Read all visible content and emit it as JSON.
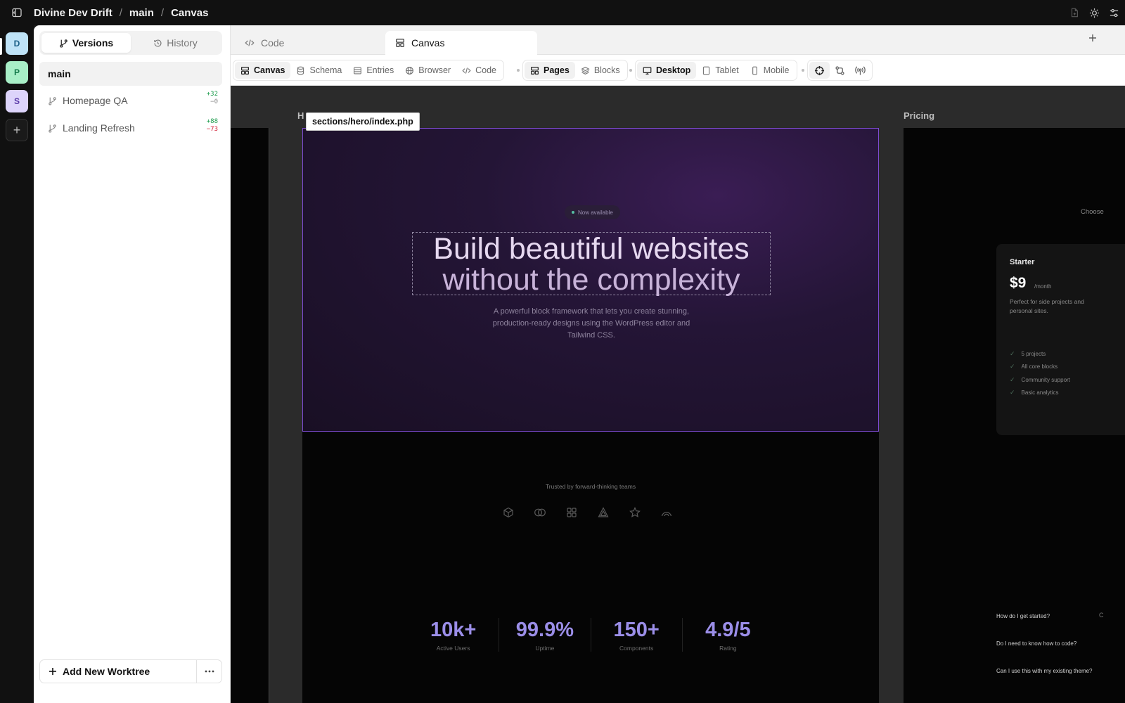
{
  "topbar": {
    "breadcrumbs": [
      "Divine Dev Drift",
      "main",
      "Canvas"
    ]
  },
  "workspaces": [
    "D",
    "P",
    "S"
  ],
  "workspace_colors": [
    "#bfe3f7",
    "#a8efc7",
    "#ddd4fb"
  ],
  "sidebar": {
    "tabs": [
      {
        "label": "Versions",
        "icon": "branch-icon",
        "active": true
      },
      {
        "label": "History",
        "icon": "history-icon",
        "active": false
      }
    ],
    "current_branch": "main",
    "worktrees": [
      {
        "name": "Homepage QA",
        "added": "+32",
        "removed": "−0"
      },
      {
        "name": "Landing Refresh",
        "added": "+88",
        "removed": "−73"
      }
    ],
    "add_worktree_label": "Add New Worktree"
  },
  "editor_tabs": [
    {
      "label": "Code",
      "icon": "code-icon",
      "active": false
    },
    {
      "label": "Canvas",
      "icon": "layout-icon",
      "active": true
    }
  ],
  "toolbar": {
    "view_group": [
      {
        "label": "Canvas",
        "icon": "layout-icon",
        "active": true
      },
      {
        "label": "Schema",
        "icon": "database-icon",
        "active": false
      },
      {
        "label": "Entries",
        "icon": "list-icon",
        "active": false
      },
      {
        "label": "Browser",
        "icon": "globe-icon",
        "active": false
      },
      {
        "label": "Code",
        "icon": "code-icon",
        "active": false
      }
    ],
    "content_group": [
      {
        "label": "Pages",
        "icon": "pages-icon",
        "active": true
      },
      {
        "label": "Blocks",
        "icon": "layers-icon",
        "active": false
      }
    ],
    "device_group": [
      {
        "label": "Desktop",
        "icon": "monitor-icon",
        "active": true
      },
      {
        "label": "Tablet",
        "icon": "tablet-icon",
        "active": false
      },
      {
        "label": "Mobile",
        "icon": "phone-icon",
        "active": false
      }
    ],
    "tools_group": [
      "crosshair-icon",
      "git-compare-icon",
      "broadcast-icon"
    ]
  },
  "canvas": {
    "home_frame_label": "H",
    "pricing_frame_label": "Pricing",
    "selected_file_tooltip": "sections/hero/index.php",
    "hero": {
      "badge": "Now available",
      "headline_line1": "Build beautiful websites",
      "headline_line2": "without the complexity",
      "subtitle": "A powerful block framework that lets you create stunning, production-ready designs using the WordPress editor and Tailwind CSS."
    },
    "trusted_text": "Trusted by forward-thinking teams",
    "logo_icons": [
      "cube-icon",
      "rings-icon",
      "grid-icon",
      "triangle-icon",
      "star-icon",
      "arc-icon"
    ],
    "stats": [
      {
        "value": "10k+",
        "label": "Active Users"
      },
      {
        "value": "99.9%",
        "label": "Uptime"
      },
      {
        "value": "150+",
        "label": "Components"
      },
      {
        "value": "4.9/5",
        "label": "Rating"
      }
    ],
    "pricing": {
      "intro_text": "Choose",
      "plan_name": "Starter",
      "price": "$9",
      "period": "/month",
      "description": "Perfect for side projects and personal sites.",
      "features": [
        "5 projects",
        "All core blocks",
        "Community support",
        "Basic analytics"
      ],
      "edge_letter": "C",
      "faq": [
        "How do I get started?",
        "Do I need to know how to code?",
        "Can I use this with my existing theme?"
      ]
    }
  },
  "colors": {
    "accent_purple": "#7d4bd1",
    "stat_value": "#9b8ee8",
    "diff_added": "#1a9b4b",
    "diff_removed": "#d2243a"
  }
}
